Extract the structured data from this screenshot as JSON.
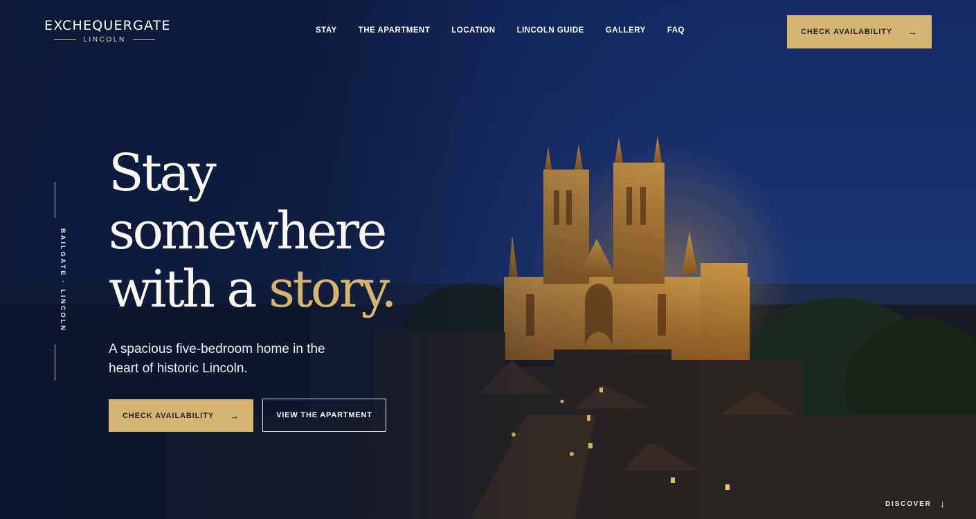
{
  "brand": {
    "name": "EXCHEQUERGATE",
    "location": "LINCOLN"
  },
  "nav": {
    "items": [
      "STAY",
      "THE APARTMENT",
      "LOCATION",
      "LINCOLN GUIDE",
      "GALLERY",
      "FAQ"
    ]
  },
  "header": {
    "cta_label": "CHECK AVAILABILITY"
  },
  "side": {
    "label_line1": "BAILGATE ·",
    "label_line2": "LINCOLN"
  },
  "hero": {
    "headline_line1": "Stay",
    "headline_line2": "somewhere",
    "headline_line3_start": "with a ",
    "headline_line3_accent": "story.",
    "subheading": "A spacious five-bedroom home in the heart of historic Lincoln.",
    "primary_cta": "CHECK AVAILABILITY",
    "secondary_cta": "VIEW THE APARTMENT"
  },
  "scroll": {
    "label": "DISCOVER"
  },
  "icons": {
    "cta_arrow": "arrow-right-icon",
    "scroll": "arrow-down-icon"
  },
  "colors": {
    "navy": "#0f1d3f",
    "gold": "#d6b572",
    "cream": "#fbf8f1"
  }
}
